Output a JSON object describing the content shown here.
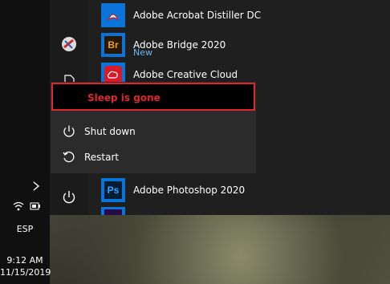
{
  "start_menu": {
    "apps": [
      {
        "name": "Adobe Acrobat Distiller DC",
        "icon": "acrobat-icon"
      },
      {
        "name": "Adobe Bridge 2020",
        "sub": "New",
        "icon": "bridge-icon",
        "tile_text": "Br"
      },
      {
        "name": "Adobe Creative Cloud",
        "icon": "creative-cloud-icon"
      },
      {
        "name": "Adobe Photoshop 2020",
        "icon": "photoshop-icon",
        "tile_text": "Ps"
      }
    ],
    "power_menu": {
      "callout": "Sleep is gone",
      "shutdown": "Shut down",
      "restart": "Restart"
    }
  },
  "taskbar": {
    "language": "ESP",
    "time": "9:12 AM",
    "date": "11/15/2019"
  },
  "colors": {
    "accent_blue": "#0a74d9",
    "callout_red": "#e0262d"
  }
}
